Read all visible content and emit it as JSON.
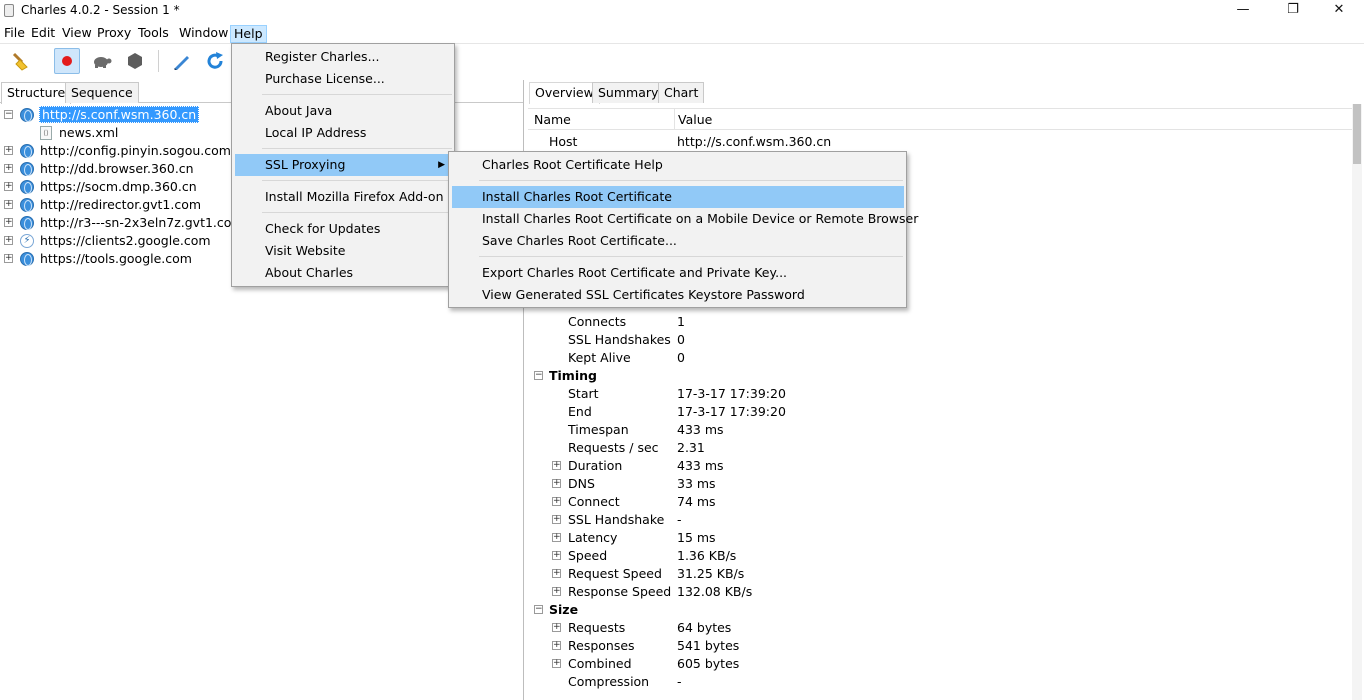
{
  "window": {
    "title": "Charles 4.0.2 - Session 1 *",
    "minimize": "—",
    "restore": "❐",
    "close": "✕"
  },
  "menubar": [
    "File",
    "Edit",
    "View",
    "Proxy",
    "Tools",
    "Window",
    "Help"
  ],
  "toolbar": {
    "icons": [
      "broom-icon",
      "record-icon",
      "throttle-turtle-icon",
      "breakpoints-hexagon-icon",
      "compose-pen-icon",
      "repeat-refresh-icon"
    ]
  },
  "left": {
    "tabs": [
      "Structure",
      "Sequence"
    ],
    "tree": [
      {
        "label": "http://s.conf.wsm.360.cn",
        "expanded": true,
        "icon": "globe-icon",
        "selected": true
      },
      {
        "label": "news.xml",
        "child": true,
        "icon": "xml-file-icon"
      },
      {
        "label": "http://config.pinyin.sogou.com",
        "icon": "globe-icon"
      },
      {
        "label": "http://dd.browser.360.cn",
        "icon": "globe-icon"
      },
      {
        "label": "https://socm.dmp.360.cn",
        "icon": "globe-icon"
      },
      {
        "label": "http://redirector.gvt1.com",
        "icon": "globe-icon"
      },
      {
        "label": "http://r3---sn-2x3eln7z.gvt1.com",
        "icon": "globe-icon"
      },
      {
        "label": "https://clients2.google.com",
        "icon": "lightning-icon"
      },
      {
        "label": "https://tools.google.com",
        "icon": "globe-icon"
      }
    ],
    "expand_symbol": "+",
    "collapse_symbol": "−"
  },
  "right": {
    "tabs": [
      "Overview",
      "Summary",
      "Chart"
    ],
    "columns": {
      "name": "Name",
      "value": "Value"
    },
    "host": {
      "name": "Host",
      "value": "http://s.conf.wsm.360.cn"
    },
    "rows": [
      {
        "name": "Connects",
        "value": "1",
        "type": "leaf"
      },
      {
        "name": "SSL Handshakes",
        "value": "0",
        "type": "leaf"
      },
      {
        "name": "Kept Alive",
        "value": "0",
        "type": "leaf"
      },
      {
        "name": "Timing",
        "value": "",
        "type": "section"
      },
      {
        "name": "Start",
        "value": "17-3-17 17:39:20",
        "type": "leaf"
      },
      {
        "name": "End",
        "value": "17-3-17 17:39:20",
        "type": "leaf"
      },
      {
        "name": "Timespan",
        "value": "433 ms",
        "type": "leaf"
      },
      {
        "name": "Requests / sec",
        "value": "2.31",
        "type": "leaf"
      },
      {
        "name": "Duration",
        "value": "433 ms",
        "type": "expandable"
      },
      {
        "name": "DNS",
        "value": "33 ms",
        "type": "expandable"
      },
      {
        "name": "Connect",
        "value": "74 ms",
        "type": "expandable"
      },
      {
        "name": "SSL Handshake",
        "value": "-",
        "type": "expandable"
      },
      {
        "name": "Latency",
        "value": "15 ms",
        "type": "expandable"
      },
      {
        "name": "Speed",
        "value": "1.36 KB/s",
        "type": "expandable"
      },
      {
        "name": "Request Speed",
        "value": "31.25 KB/s",
        "type": "expandable"
      },
      {
        "name": "Response Speed",
        "value": "132.08 KB/s",
        "type": "expandable"
      },
      {
        "name": "Size",
        "value": "",
        "type": "section"
      },
      {
        "name": "Requests",
        "value": "64 bytes",
        "type": "expandable"
      },
      {
        "name": "Responses",
        "value": "541 bytes",
        "type": "expandable"
      },
      {
        "name": "Combined",
        "value": "605 bytes",
        "type": "expandable"
      },
      {
        "name": "Compression",
        "value": "-",
        "type": "leaf"
      }
    ]
  },
  "help_menu": {
    "groups": [
      [
        "Register Charles...",
        "Purchase License..."
      ],
      [
        "About Java",
        "Local IP Address"
      ],
      [
        "SSL Proxying"
      ],
      [
        "Install Mozilla Firefox Add-on"
      ],
      [
        "Check for Updates",
        "Visit Website",
        "About Charles"
      ]
    ],
    "highlighted": "SSL Proxying",
    "arrow": "▶"
  },
  "ssl_submenu": {
    "groups": [
      [
        "Charles Root Certificate Help"
      ],
      [
        "Install Charles Root Certificate",
        "Install Charles Root Certificate on a Mobile Device or Remote Browser",
        "Save Charles Root Certificate..."
      ],
      [
        "Export Charles Root Certificate and Private Key...",
        "View Generated SSL Certificates Keystore Password"
      ]
    ],
    "highlighted": "Install Charles Root Certificate"
  }
}
